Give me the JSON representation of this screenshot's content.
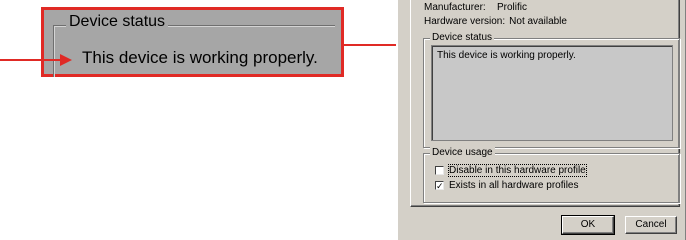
{
  "callout": {
    "legend": "Device status",
    "text": "This device is working properly."
  },
  "dialog": {
    "manufacturer_label": "Manufacturer:",
    "manufacturer_value": "Prolific",
    "hardware_label": "Hardware version:",
    "hardware_value": "Not available",
    "device_status": {
      "legend": "Device status",
      "text": "This device is working properly."
    },
    "device_usage": {
      "legend": "Device usage",
      "options": [
        {
          "label": "Disable in this hardware profile",
          "checked": false
        },
        {
          "label": "Exists in all hardware profiles",
          "checked": true
        }
      ]
    },
    "buttons": {
      "ok": "OK",
      "cancel": "Cancel"
    }
  },
  "colors": {
    "callout_border": "#e02a25",
    "arrow": "#e02a25",
    "dialog_bg": "#d4d0c8"
  }
}
